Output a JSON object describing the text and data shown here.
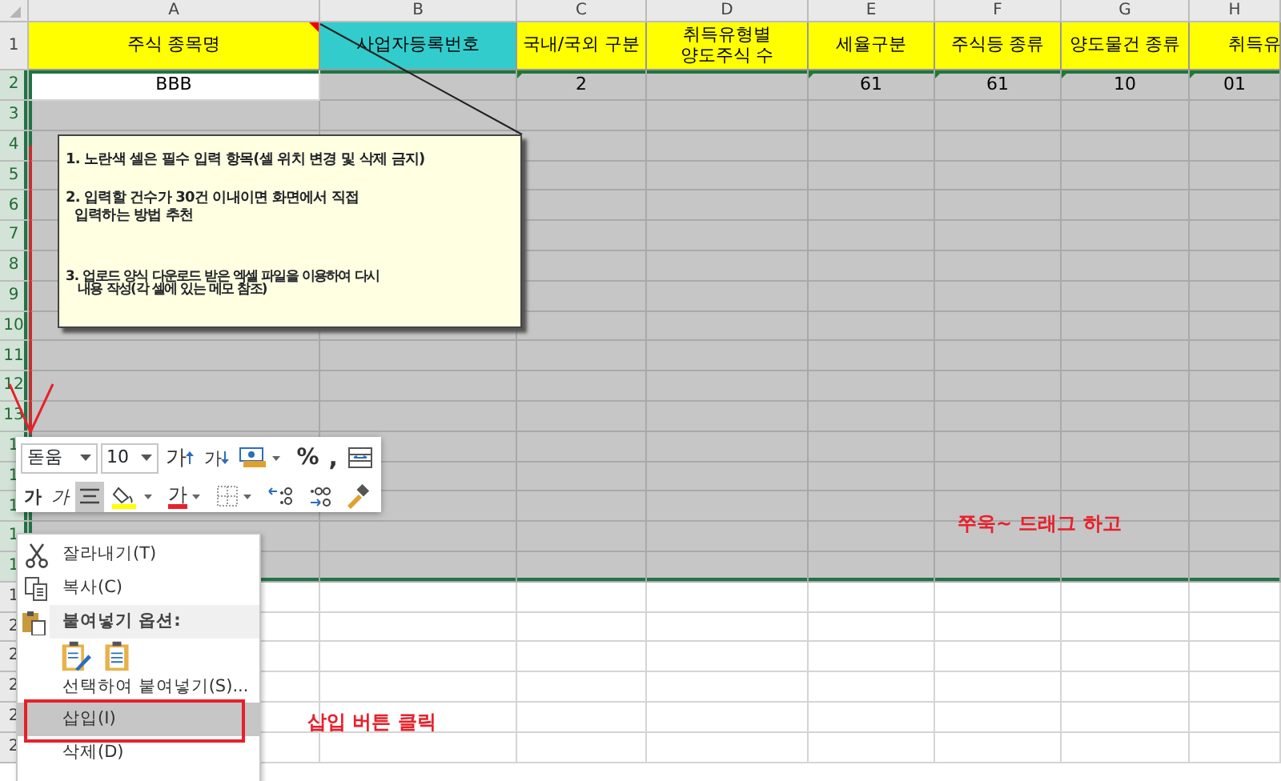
{
  "columns": [
    "A",
    "B",
    "C",
    "D",
    "E",
    "F",
    "G",
    "H"
  ],
  "header_row": {
    "label": "1",
    "cells": [
      {
        "text": "주식 종목명",
        "color": "#ffff00",
        "comment": true
      },
      {
        "text": "사업자등록번호",
        "color": "#33cccc",
        "comment": false
      },
      {
        "text": "국내/국외 구분",
        "color": "#ffff00",
        "comment": false
      },
      {
        "text": "취득유형별\n양도주식 수",
        "color": "#ffff00",
        "comment": false
      },
      {
        "text": "세율구분",
        "color": "#ffff00",
        "comment": false
      },
      {
        "text": "주식등 종류",
        "color": "#ffff00",
        "comment": false
      },
      {
        "text": "양도물건 종류",
        "color": "#ffff00",
        "comment": false
      },
      {
        "text": "취득유",
        "color": "#ffff00",
        "comment": false
      }
    ]
  },
  "data_row": {
    "label": "2",
    "selected": true,
    "cells": [
      {
        "text": "BBB",
        "active": true,
        "flag": false
      },
      {
        "active": false,
        "flag": false
      },
      {
        "text": "2",
        "active": false,
        "flag": true
      },
      {
        "active": false,
        "flag": false
      },
      {
        "text": "61",
        "active": false,
        "flag": true
      },
      {
        "text": "61",
        "active": false,
        "flag": true
      },
      {
        "text": "10",
        "active": false,
        "flag": true
      },
      {
        "text": "01",
        "active": false,
        "flag": true
      }
    ]
  },
  "rows": [
    {
      "label": "3",
      "selected": true
    },
    {
      "label": "4",
      "selected": true
    },
    {
      "label": "5",
      "selected": true
    },
    {
      "label": "6",
      "selected": true
    },
    {
      "label": "7",
      "selected": true
    },
    {
      "label": "8",
      "selected": true
    },
    {
      "label": "9",
      "selected": true
    },
    {
      "label": "10",
      "selected": true
    },
    {
      "label": "11",
      "selected": true
    },
    {
      "label": "12",
      "selected": true
    },
    {
      "label": "13",
      "selected": true
    },
    {
      "label": "1",
      "selected": true
    },
    {
      "label": "1",
      "selected": true
    },
    {
      "label": "1",
      "selected": true
    },
    {
      "label": "1",
      "selected": true
    },
    {
      "label": "1",
      "selected": true
    },
    {
      "label": "1",
      "selected": false
    },
    {
      "label": "2",
      "selected": false
    },
    {
      "label": "2",
      "selected": false
    },
    {
      "label": "2",
      "selected": false
    },
    {
      "label": "2",
      "selected": false
    },
    {
      "label": "2",
      "selected": false
    }
  ],
  "comment": {
    "paragraphs": [
      "1. 노란색 셀은 필수 입력 항목(셀 위치 변경 및 삭제 금지)",
      "2. 입력할 건수가 30건 이내이면 화면에서 직접\n  입력하는 방법 추천",
      "3. 업로드 양식 다운로드 받은 엑셀 파일을 이용하여 다시\n   내용 작성(각 셀에 있는 메모 참조)"
    ]
  },
  "mini_toolbar": {
    "font": "돋움",
    "size": "10",
    "row_1": [
      {
        "kind": "grow",
        "label": "가",
        "selected": false
      },
      {
        "kind": "shrink",
        "label": "가",
        "selected": false
      },
      {
        "kind": "currency",
        "selected": false
      },
      {
        "kind": "percent",
        "label": "%",
        "selected": false
      },
      {
        "kind": "comma",
        "label": ",",
        "selected": false
      },
      {
        "kind": "merge",
        "selected": false
      }
    ],
    "row_2": [
      {
        "kind": "bold",
        "label": "가",
        "selected": false
      },
      {
        "kind": "italic",
        "label": "가",
        "selected": false
      },
      {
        "kind": "align",
        "selected": true
      },
      {
        "kind": "fill",
        "selected": false
      },
      {
        "kind": "fontcolor",
        "label": "가",
        "selected": false
      },
      {
        "kind": "borders",
        "selected": false
      },
      {
        "kind": "incdec",
        "selected": false
      },
      {
        "kind": "decdec",
        "selected": false
      },
      {
        "kind": "painter",
        "selected": false
      }
    ]
  },
  "context_menu": {
    "items": [
      {
        "kind": "cut",
        "label": "잘라내기(T)",
        "selected": false
      },
      {
        "kind": "copy",
        "label": "복사(C)",
        "selected": false
      },
      {
        "kind": "section",
        "label": "붙여넣기 옵션:",
        "selected": false
      },
      {
        "kind": "paste-options",
        "selected": false
      },
      {
        "kind": "command",
        "label": "선택하여 붙여넣기(S)...",
        "selected": false
      },
      {
        "kind": "command",
        "label": "삽입(I)",
        "selected": true
      },
      {
        "kind": "command",
        "label": "삭제(D)",
        "selected": false
      }
    ]
  },
  "annotations": [
    {
      "text": "쭈욱~ 드래그 하고"
    },
    {
      "text": "삽입 버튼 클릭"
    }
  ]
}
